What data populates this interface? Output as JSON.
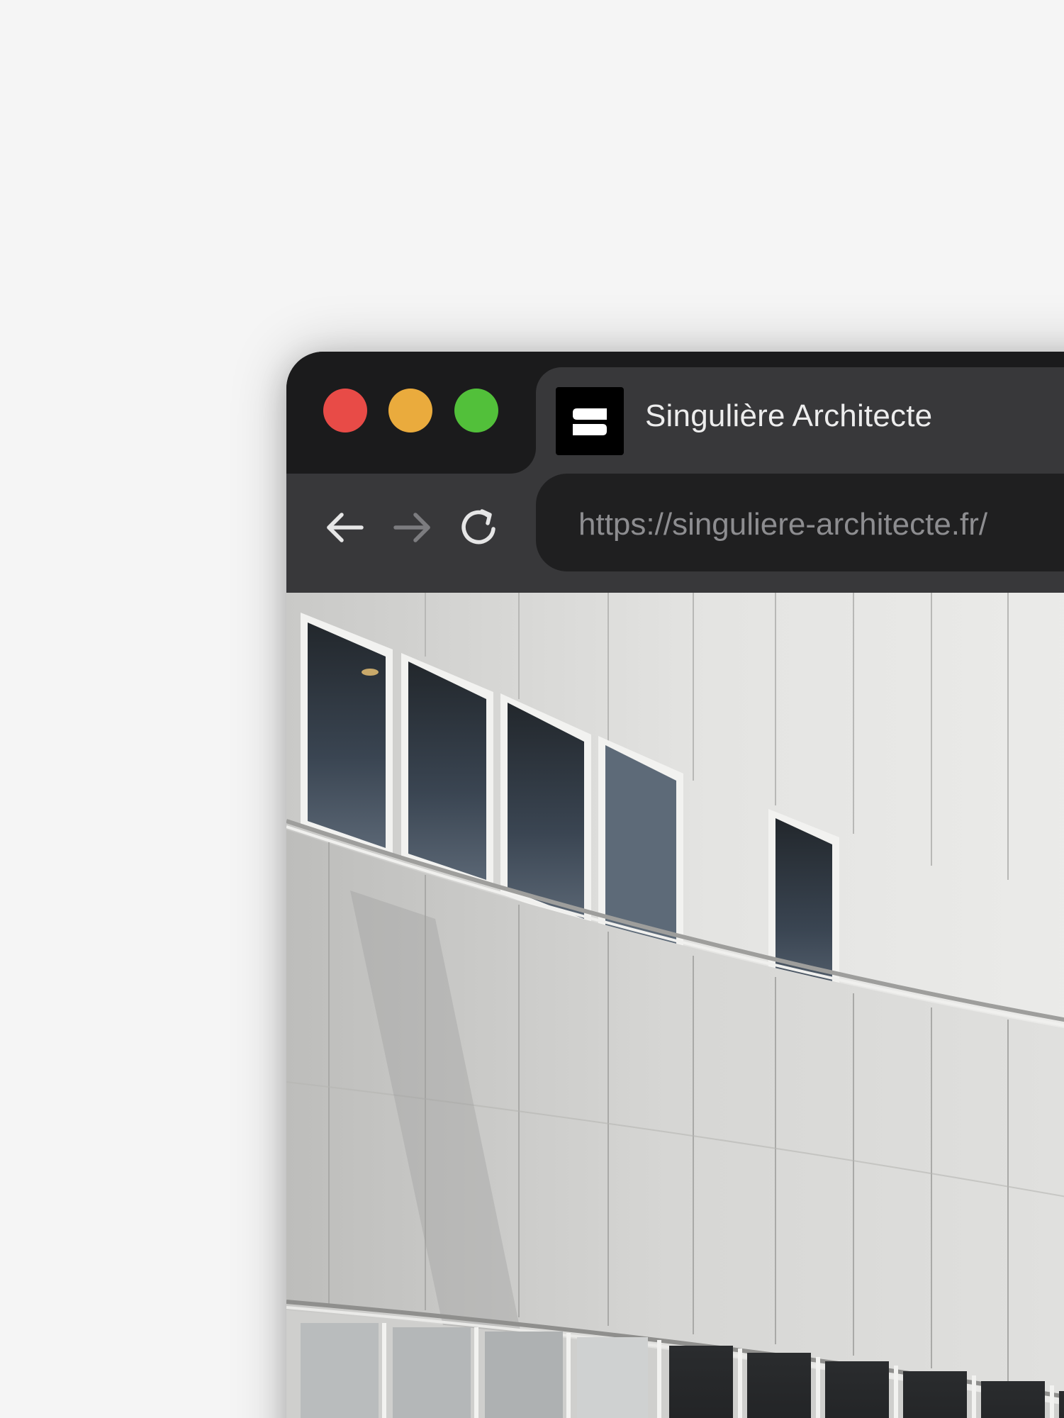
{
  "window": {
    "traffic_lights": {
      "close_color": "#e84b47",
      "minimize_color": "#eaab3d",
      "maximize_color": "#52c03a"
    }
  },
  "tab": {
    "title": "Singulière Architecte",
    "favicon_icon": "logo-s-icon"
  },
  "toolbar": {
    "back_icon": "arrow-left-icon",
    "forward_icon": "arrow-right-icon",
    "reload_icon": "reload-icon",
    "url": "https://singuliere-architecte.fr/"
  },
  "content": {
    "image_subject": "curved-building-facade"
  }
}
